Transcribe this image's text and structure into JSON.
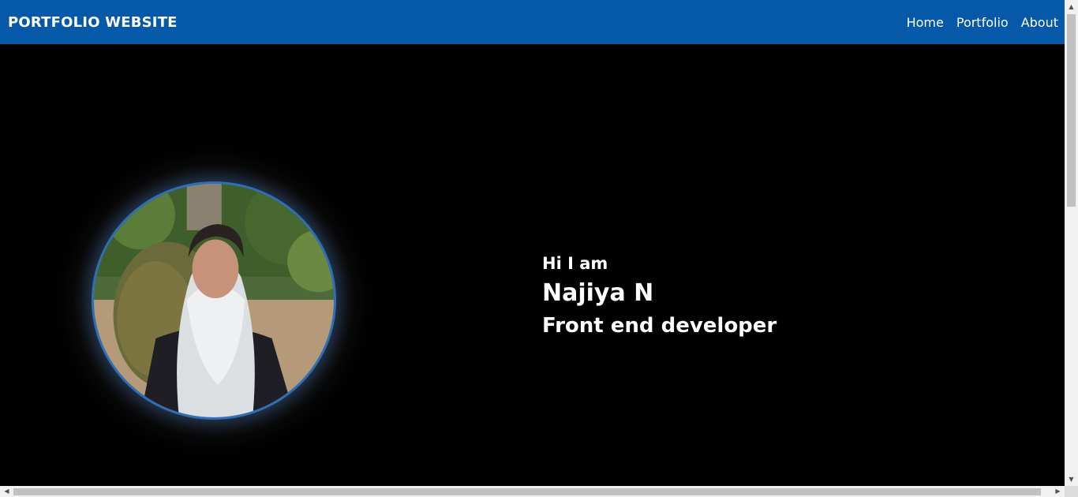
{
  "navbar": {
    "brand": "PORTFOLIO WEBSITE",
    "links": [
      "Home",
      "Portfolio",
      "About"
    ]
  },
  "hero": {
    "greeting": "Hi I am",
    "name": "Najiya N",
    "role": "Front end developer"
  },
  "colors": {
    "navbar_bg": "#0658a8",
    "page_bg": "#000000",
    "text": "#ffffff",
    "photo_ring": "#2f6fb8"
  },
  "icons": {
    "scroll_up": "triangle-up",
    "scroll_down": "triangle-down",
    "scroll_left": "triangle-left",
    "scroll_right": "triangle-right"
  }
}
